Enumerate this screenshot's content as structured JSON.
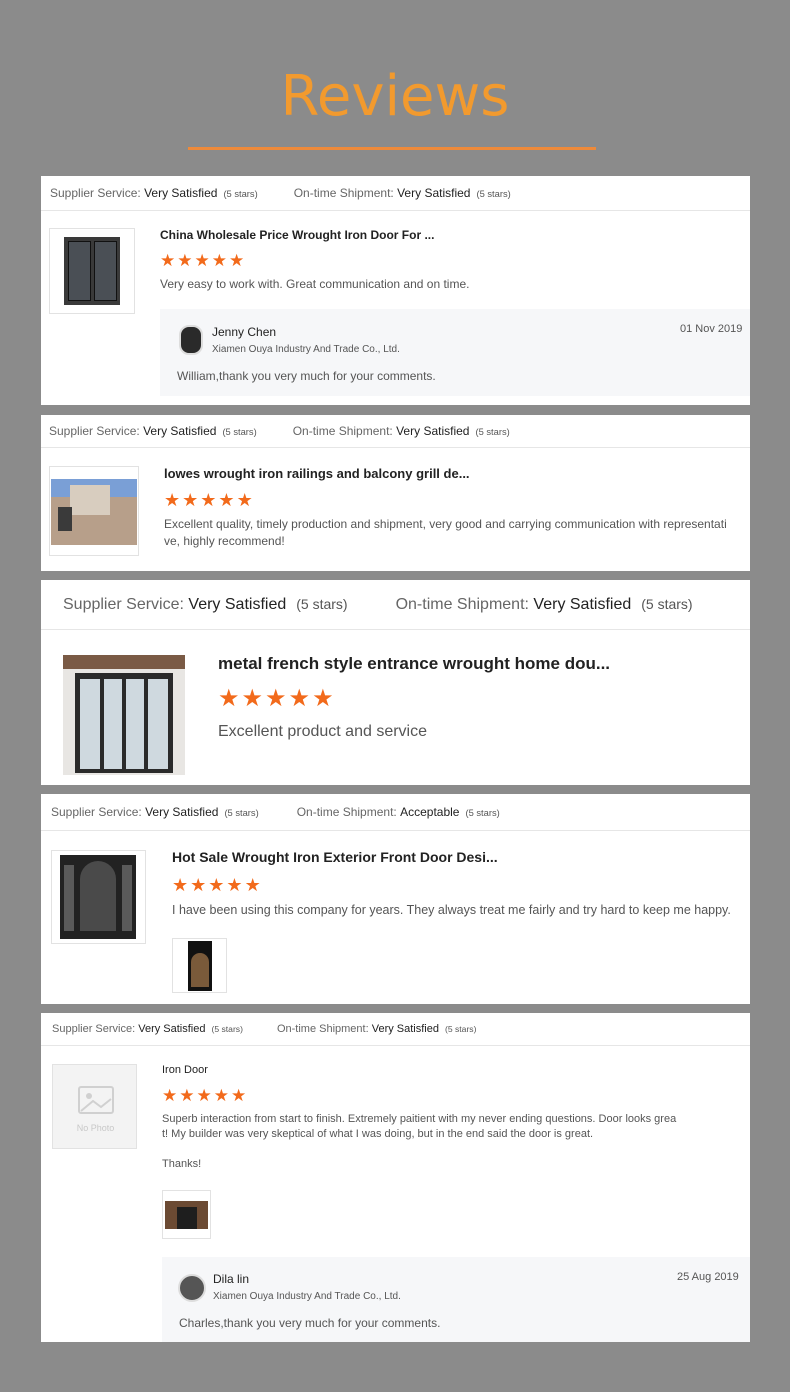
{
  "page": {
    "heading": "Reviews"
  },
  "reviews": [
    {
      "supplier_label": "Supplier Service:",
      "supplier_value": "Very Satisfied",
      "supplier_stars": "(5 stars)",
      "shipment_label": "On-time Shipment:",
      "shipment_value": "Very Satisfied",
      "shipment_stars": "(5 stars)",
      "title": "China Wholesale Price Wrought Iron Door For ...",
      "rating": 5,
      "text": "Very easy to work with.  Great communication and on time.",
      "reply": {
        "name": "Jenny Chen",
        "company": "Xiamen Ouya Industry And Trade Co., Ltd.",
        "date": "01 Nov 2019",
        "message": "William,thank you very much for your comments."
      }
    },
    {
      "supplier_label": "Supplier Service:",
      "supplier_value": "Very Satisfied",
      "supplier_stars": "(5 stars)",
      "shipment_label": "On-time Shipment:",
      "shipment_value": "Very Satisfied",
      "shipment_stars": "(5 stars)",
      "title": "lowes wrought iron railings and balcony grill de...",
      "rating": 5,
      "text_line1": "Excellent quality, timely production and shipment, very good and carrying communication with representati",
      "text_line2": "ve, highly recommend!"
    },
    {
      "supplier_label": "Supplier Service:",
      "supplier_value": "Very Satisfied",
      "supplier_stars": "(5 stars)",
      "shipment_label": "On-time Shipment:",
      "shipment_value": "Very Satisfied",
      "shipment_stars": "(5 stars)",
      "title": "metal french style entrance wrought home dou...",
      "rating": 5,
      "text": "Excellent product and service"
    },
    {
      "supplier_label": "Supplier Service:",
      "supplier_value": "Very Satisfied",
      "supplier_stars": "(5 stars)",
      "shipment_label": "On-time Shipment:",
      "shipment_value": "Acceptable",
      "shipment_stars": "(5 stars)",
      "title": "Hot Sale Wrought Iron Exterior Front Door Desi...",
      "rating": 5,
      "text": "I have been using this company for years. They always treat me fairly and try hard to keep me happy."
    },
    {
      "supplier_label": "Supplier Service:",
      "supplier_value": "Very Satisfied",
      "supplier_stars": "(5 stars)",
      "shipment_label": "On-time Shipment:",
      "shipment_value": "Very Satisfied",
      "shipment_stars": "(5 stars)",
      "title": "Iron Door",
      "rating": 5,
      "no_photo": "No Photo",
      "text_line1": "Superb interaction from start to finish. Extremely paitient with my never ending questions. Door looks grea",
      "text_line2": "t! My builder was very skeptical of what I was doing, but in the end said the door is great.",
      "text_line3": "Thanks!",
      "reply": {
        "name": "Dila lin",
        "company": "Xiamen Ouya Industry And Trade Co., Ltd.",
        "date": "25 Aug 2019",
        "message": "Charles,thank you very much for your comments."
      }
    }
  ],
  "icons": {
    "star": "star-icon",
    "avatar": "avatar",
    "no_photo": "image-placeholder-icon"
  },
  "colors": {
    "accent_orange": "#f26a1b",
    "heading_orange": "#f29a2e",
    "background": "#8b8b8b"
  }
}
